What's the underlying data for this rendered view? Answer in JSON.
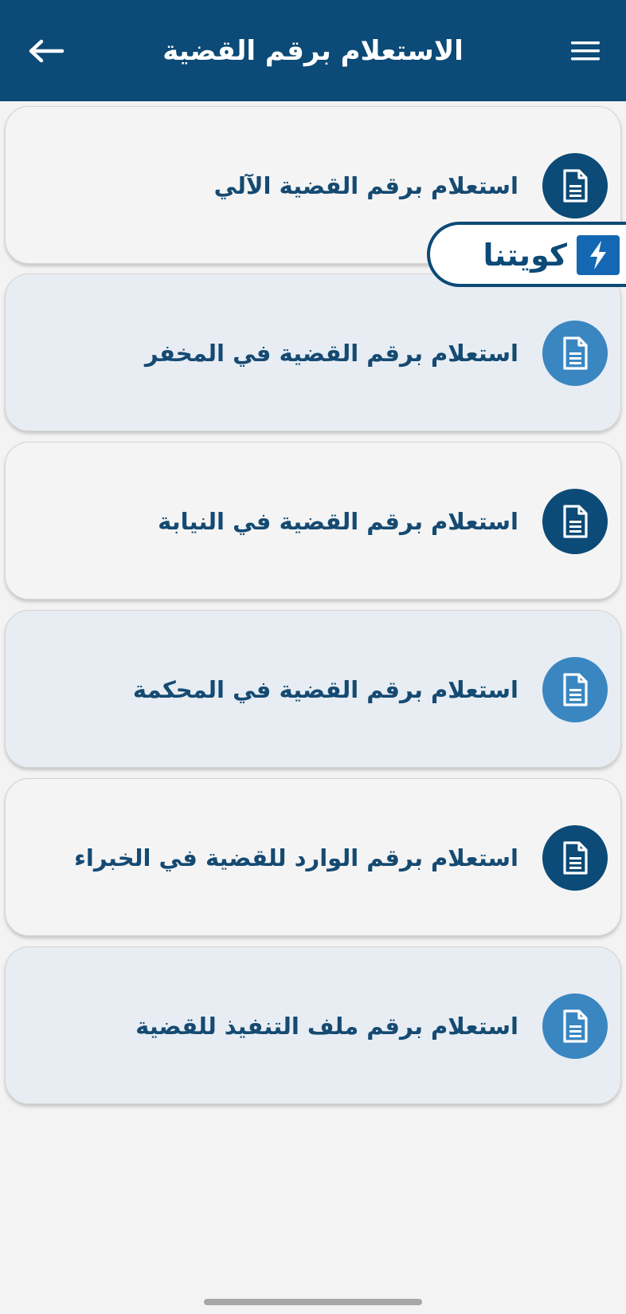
{
  "header": {
    "title": "الاستعلام برقم القضية",
    "back_icon": "arrow-left-icon",
    "menu_icon": "hamburger-menu-icon",
    "color": "#0c4a77"
  },
  "items": [
    {
      "label": "استعلام برقم القضية الآلي",
      "icon": "document-icon",
      "style": "light"
    },
    {
      "label": "استعلام برقم القضية في المخفر",
      "icon": "document-icon",
      "style": "blue"
    },
    {
      "label": "استعلام برقم القضية في النيابة",
      "icon": "document-icon",
      "style": "light"
    },
    {
      "label": "استعلام برقم القضية في المحكمة",
      "icon": "document-icon",
      "style": "blue"
    },
    {
      "label": "استعلام برقم الوارد للقضية في الخبراء",
      "icon": "document-icon",
      "style": "light"
    },
    {
      "label": "استعلام برقم ملف التنفيذ للقضية",
      "icon": "document-icon",
      "style": "blue"
    }
  ],
  "watermark": {
    "text": "كويتنا",
    "icon": "lightning-logo-icon",
    "accent": "#1467b3"
  },
  "colors": {
    "background": "#f3f3f3",
    "card_light": "#f4f4f4",
    "card_blue": "#e7edf3",
    "icon_dark": "#0c4a77",
    "icon_light": "#3a86c1",
    "label_text": "#154a72"
  }
}
